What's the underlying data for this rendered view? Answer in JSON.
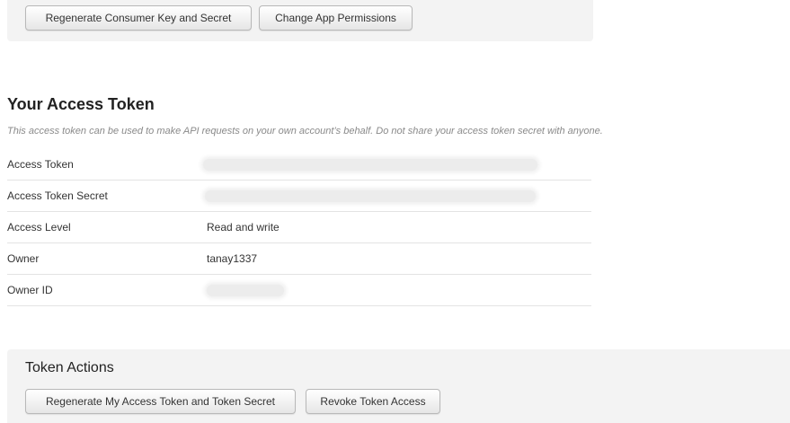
{
  "app_actions": {
    "regenerate_consumer_label": "Regenerate Consumer Key and Secret",
    "change_permissions_label": "Change App Permissions"
  },
  "access_token": {
    "title": "Your Access Token",
    "description": "This access token can be used to make API requests on your own account’s behalf. Do not share your access token secret with anyone.",
    "rows": [
      {
        "label": "Access Token",
        "value": "",
        "redacted": true
      },
      {
        "label": "Access Token Secret",
        "value": "",
        "redacted": true
      },
      {
        "label": "Access Level",
        "value": "Read and write",
        "redacted": false
      },
      {
        "label": "Owner",
        "value": "tanay1337",
        "redacted": false
      },
      {
        "label": "Owner ID",
        "value": "",
        "redacted": true
      }
    ]
  },
  "token_actions": {
    "title": "Token Actions",
    "regenerate_label": "Regenerate My Access Token and Token Secret",
    "revoke_label": "Revoke Token Access"
  },
  "colors": {
    "panel_background": "#f3f3f3",
    "divider": "#e3e3e3",
    "description_text": "#8a8a8a"
  }
}
